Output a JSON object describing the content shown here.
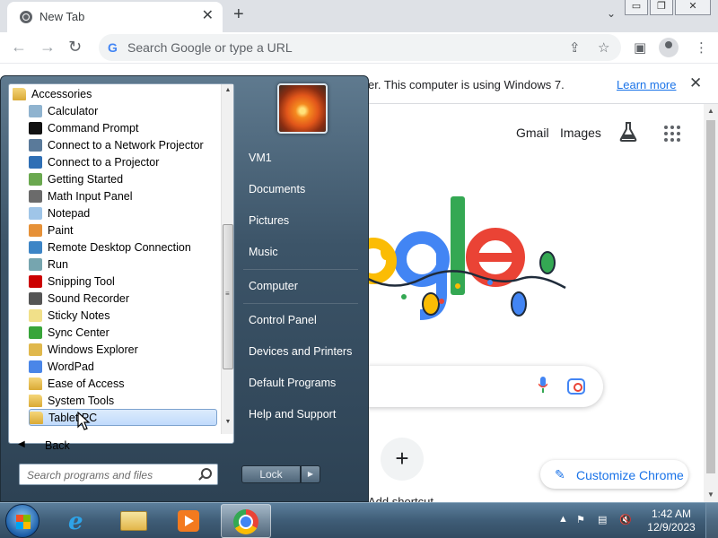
{
  "browser": {
    "tab_title": "New Tab",
    "omnibox_placeholder": "Search Google or type a URL",
    "window_buttons": {
      "minimize": "▭",
      "restore": "❐",
      "close": "✕"
    }
  },
  "infobar": {
    "text": "er. This computer is using Windows 7.",
    "learn_more": "Learn more"
  },
  "ntp": {
    "gmail": "Gmail",
    "images": "Images",
    "shortcut_label": "Add shortcut",
    "customize_label": "Customize Chrome"
  },
  "start_menu": {
    "programs": [
      {
        "label": "Accessories",
        "icon": "folder-icon",
        "indent": false
      },
      {
        "label": "Calculator",
        "icon": "calculator-icon",
        "indent": true
      },
      {
        "label": "Command Prompt",
        "icon": "command-prompt-icon",
        "indent": true
      },
      {
        "label": "Connect to a Network Projector",
        "icon": "network-projector-icon",
        "indent": true
      },
      {
        "label": "Connect to a Projector",
        "icon": "projector-icon",
        "indent": true
      },
      {
        "label": "Getting Started",
        "icon": "getting-started-icon",
        "indent": true
      },
      {
        "label": "Math Input Panel",
        "icon": "math-input-icon",
        "indent": true
      },
      {
        "label": "Notepad",
        "icon": "notepad-icon",
        "indent": true
      },
      {
        "label": "Paint",
        "icon": "paint-icon",
        "indent": true
      },
      {
        "label": "Remote Desktop Connection",
        "icon": "remote-desktop-icon",
        "indent": true
      },
      {
        "label": "Run",
        "icon": "run-icon",
        "indent": true
      },
      {
        "label": "Snipping Tool",
        "icon": "snipping-tool-icon",
        "indent": true
      },
      {
        "label": "Sound Recorder",
        "icon": "microphone-icon",
        "indent": true
      },
      {
        "label": "Sticky Notes",
        "icon": "sticky-notes-icon",
        "indent": true
      },
      {
        "label": "Sync Center",
        "icon": "sync-center-icon",
        "indent": true
      },
      {
        "label": "Windows Explorer",
        "icon": "explorer-icon",
        "indent": true
      },
      {
        "label": "WordPad",
        "icon": "wordpad-icon",
        "indent": true
      },
      {
        "label": "Ease of Access",
        "icon": "folder-icon",
        "indent": true
      },
      {
        "label": "System Tools",
        "icon": "folder-icon",
        "indent": true
      },
      {
        "label": "Tablet PC",
        "icon": "folder-icon",
        "indent": true,
        "selected": true
      }
    ],
    "back_label": "Back",
    "search_placeholder": "Search programs and files",
    "right_items": [
      "VM1",
      "Documents",
      "Pictures",
      "Music",
      "Computer",
      "Control Panel",
      "Devices and Printers",
      "Default Programs",
      "Help and Support"
    ],
    "lock_label": "Lock"
  },
  "taskbar": {
    "time": "1:42 AM",
    "date": "12/9/2023"
  },
  "colors": {
    "accent_blue": "#1a73e8",
    "start_menu_bg": "#3c5468",
    "taskbar_bg": "#3f5d77"
  }
}
